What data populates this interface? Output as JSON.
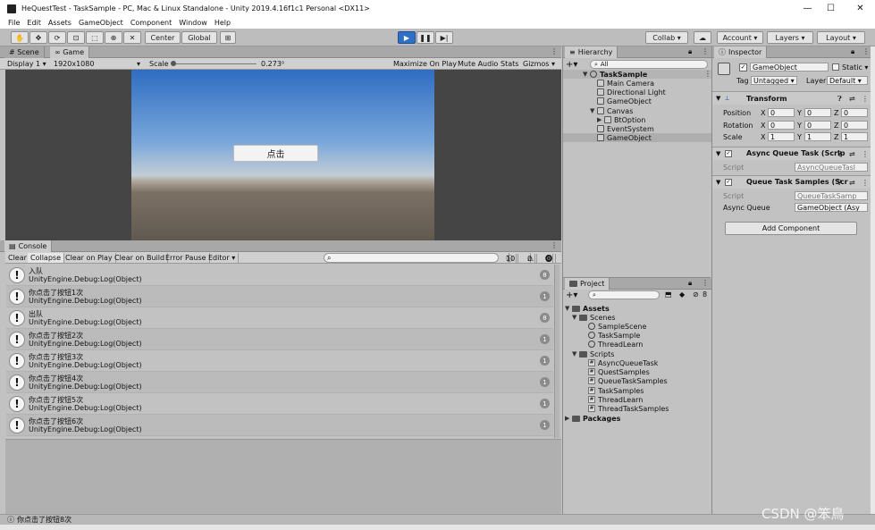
{
  "window": {
    "title": "HeQuestTest - TaskSample - PC, Mac & Linux Standalone - Unity 2019.4.16f1c1 Personal <DX11>",
    "min": "—",
    "max": "☐",
    "close": "✕"
  },
  "menu": [
    "File",
    "Edit",
    "Assets",
    "GameObject",
    "Component",
    "Window",
    "Help"
  ],
  "toolbar": {
    "center": "Center",
    "global": "Global",
    "collab": "Collab ▾",
    "account": "Account ▾",
    "layers": "Layers ▾",
    "layout": "Layout ▾",
    "play": "▶",
    "pause": "❚❚",
    "step": "▶|"
  },
  "scene_game": {
    "tabs": [
      "# Scene",
      "∞ Game"
    ],
    "display": "Display 1 ▾",
    "resolution": "1920x1080",
    "resolution_arrow": "▾",
    "scale_label": "Scale",
    "scale_value": "0.273⁰",
    "options": [
      "Maximize On Play",
      "Mute Audio",
      "Stats",
      "Gizmos ▾"
    ],
    "button_text": "点击"
  },
  "console": {
    "tab": "Console",
    "buttons": [
      "Clear",
      "Collapse",
      "Clear on Play",
      "Clear on Build",
      "Error Pause",
      "Editor ▾"
    ],
    "counts": {
      "info": "10",
      "warn": "0",
      "error": "0"
    },
    "rows": [
      {
        "msg": "入队",
        "sub": "UnityEngine.Debug:Log(Object)",
        "count": "8"
      },
      {
        "msg": "你点击了按钮1次",
        "sub": "UnityEngine.Debug:Log(Object)",
        "count": "1"
      },
      {
        "msg": "出队",
        "sub": "UnityEngine.Debug:Log(Object)",
        "count": "8"
      },
      {
        "msg": "你点击了按钮2次",
        "sub": "UnityEngine.Debug:Log(Object)",
        "count": "1"
      },
      {
        "msg": "你点击了按钮3次",
        "sub": "UnityEngine.Debug:Log(Object)",
        "count": "1"
      },
      {
        "msg": "你点击了按钮4次",
        "sub": "UnityEngine.Debug:Log(Object)",
        "count": "1"
      },
      {
        "msg": "你点击了按钮5次",
        "sub": "UnityEngine.Debug:Log(Object)",
        "count": "1"
      },
      {
        "msg": "你点击了按钮6次",
        "sub": "UnityEngine.Debug:Log(Object)",
        "count": "1"
      }
    ],
    "status": "你点击了按钮8次"
  },
  "hierarchy": {
    "tab": "Hierarchy",
    "search": "All",
    "items": [
      "TaskSample",
      "Main Camera",
      "Directional Light",
      "GameObject",
      "Canvas",
      "BtOption",
      "EventSystem",
      "GameObject"
    ]
  },
  "project": {
    "tab": "Project",
    "badge": "8",
    "items": [
      "Assets",
      "Scenes",
      "SampleScene",
      "TaskSample",
      "ThreadLearn",
      "Scripts",
      "AsyncQueueTask",
      "QuestSamples",
      "QueueTaskSamples",
      "TaskSamples",
      "ThreadLearn",
      "ThreadTaskSamples",
      "Packages"
    ]
  },
  "inspector": {
    "tab": "Inspector",
    "name": "GameObject",
    "static": "Static ▾",
    "tag_label": "Tag",
    "tag": "Untagged ▾",
    "layer_label": "Layer",
    "layer": "Default ▾",
    "transform": "Transform",
    "rows": [
      {
        "label": "Position",
        "x": "0",
        "y": "0",
        "z": "0"
      },
      {
        "label": "Rotation",
        "x": "0",
        "y": "0",
        "z": "0"
      },
      {
        "label": "Scale",
        "x": "1",
        "y": "1",
        "z": "1"
      }
    ],
    "axis": {
      "x": "X",
      "y": "Y",
      "z": "Z"
    },
    "comp1": "Async Queue Task (Scrip",
    "comp1_script_label": "Script",
    "comp1_script": "AsyncQueueTasl",
    "comp2": "Queue Task Samples (Scr",
    "comp2_script_label": "Script",
    "comp2_script": "QueueTaskSamp",
    "comp2_field_label": "Async Queue",
    "comp2_field": "GameObject (Asy",
    "add_component": "Add Component"
  },
  "watermark": "CSDN @笨鳥",
  "colors": {
    "accent": "#2f6fc6",
    "panel": "#c2c2c2",
    "game_bg": "#454545"
  }
}
